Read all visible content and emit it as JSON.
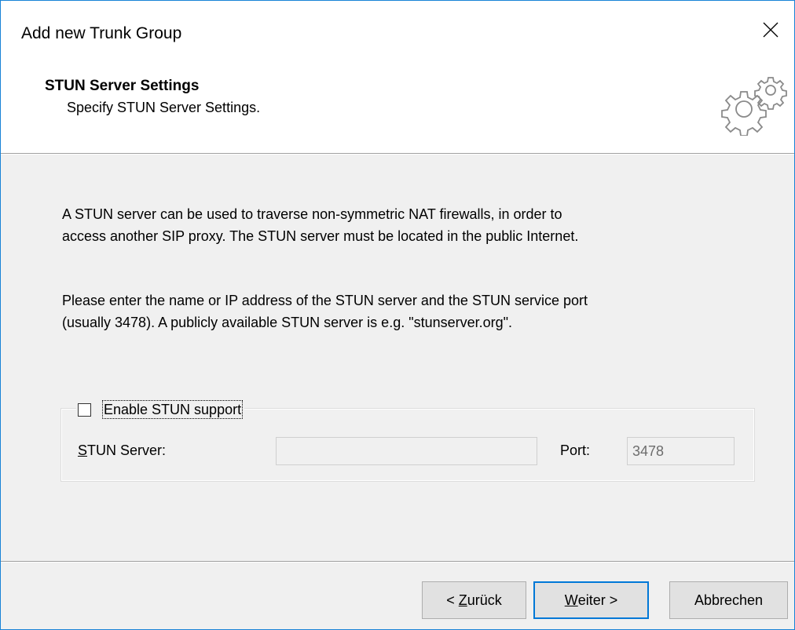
{
  "window": {
    "title": "Add new Trunk Group"
  },
  "header": {
    "title": "STUN Server Settings",
    "subtitle": "Specify STUN Server Settings.",
    "icon": "gears-icon"
  },
  "body": {
    "paragraph1_line1": "A STUN server can be used to traverse non-symmetric NAT firewalls, in order to",
    "paragraph1_line2": "access another SIP proxy.  The STUN server must be located in the public Internet.",
    "paragraph2_line1": "Please enter the name or IP address of the STUN server and the STUN service port",
    "paragraph2_line2": "(usually 3478). A publicly available STUN server is e.g. \"stunserver.org\"."
  },
  "stun_group": {
    "enable_label": "Enable STUN support",
    "enabled": false,
    "server_label_accel": "S",
    "server_label_rest": "TUN Server:",
    "server_value": "",
    "port_label": "Port:",
    "port_value": "3478"
  },
  "buttons": {
    "back_prefix": "< ",
    "back_accel": "Z",
    "back_rest": "urück",
    "next_accel": "W",
    "next_rest": "eiter >",
    "cancel": "Abbrechen"
  },
  "colors": {
    "window_border": "#1883d7",
    "default_button_border": "#0078d7"
  }
}
